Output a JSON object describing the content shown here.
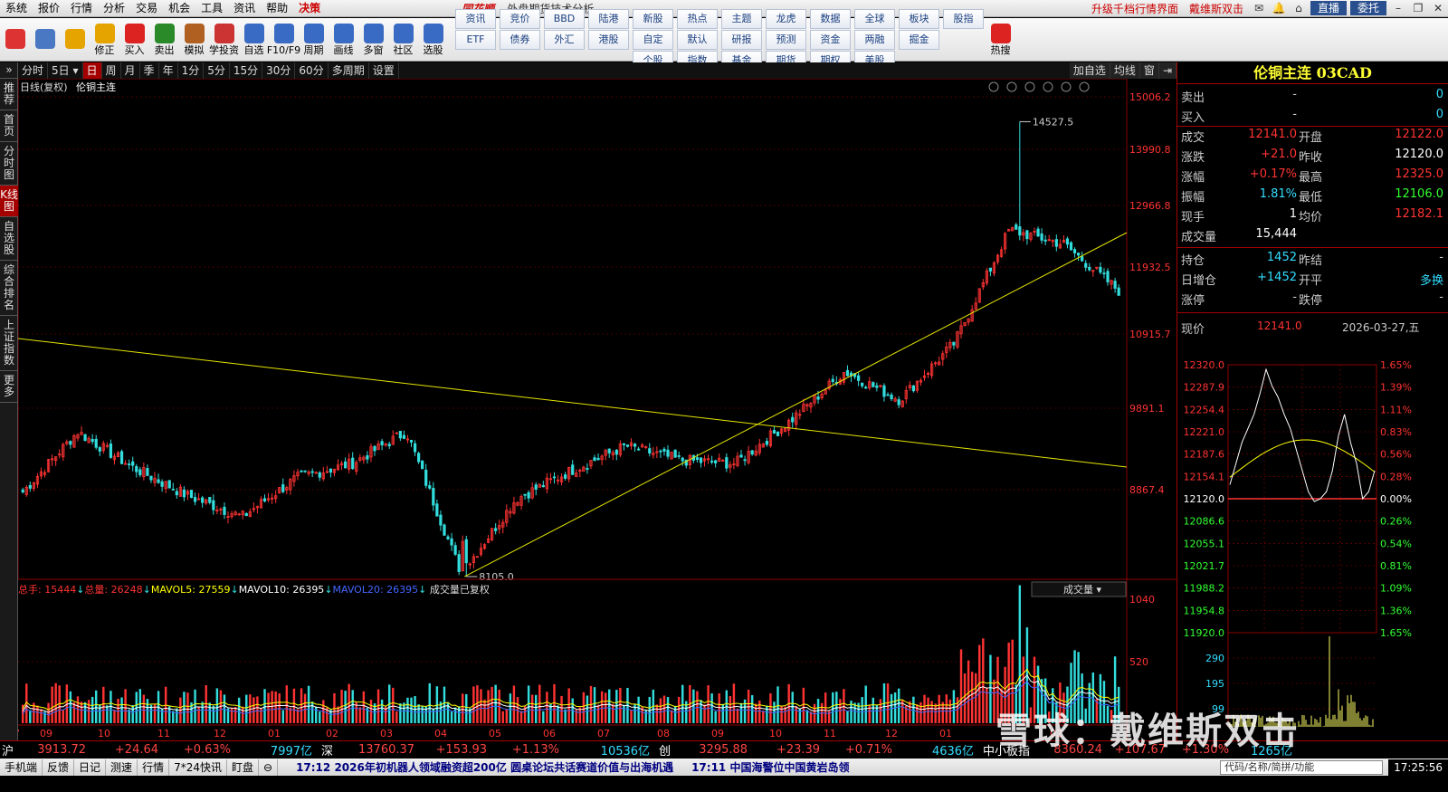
{
  "menubar": {
    "items": [
      "系统",
      "报价",
      "行情",
      "分析",
      "交易",
      "机会",
      "工具",
      "资讯",
      "帮助",
      "决策"
    ],
    "brand": "同花顺",
    "subtitle": "- 外盘期货技术分析",
    "link1": "升级千档行情界面",
    "link2": "戴维斯双击",
    "btn_live": "直播",
    "btn_trust": "委托"
  },
  "toolbar": {
    "big": [
      {
        "label": "",
        "icon": "multi-window-icon",
        "color": "#d33"
      },
      {
        "label": "",
        "icon": "ai-icon",
        "color": "#4a78c2"
      },
      {
        "label": "",
        "icon": "back-arrow-icon",
        "color": "#e5a400"
      },
      {
        "label": "修正",
        "icon": "fix-icon",
        "color": "#e5a400"
      },
      {
        "label": "买入",
        "icon": "buy-icon",
        "color": "#d22"
      },
      {
        "label": "卖出",
        "icon": "sell-icon",
        "color": "#2a8a2a"
      },
      {
        "label": "模拟",
        "icon": "hammer-icon",
        "color": "#b06020"
      },
      {
        "label": "学投资",
        "icon": "learn-icon",
        "color": "#c33"
      },
      {
        "label": "自选",
        "icon": "star-icon",
        "color": "#3a6bc4"
      },
      {
        "label": "F10/F9",
        "icon": "f10-icon",
        "color": "#3a6bc4"
      },
      {
        "label": "周期",
        "icon": "clock-icon",
        "color": "#3a6bc4"
      },
      {
        "label": "画线",
        "icon": "pen-icon",
        "color": "#3a6bc4"
      },
      {
        "label": "多窗",
        "icon": "windows-icon",
        "color": "#3a6bc4"
      },
      {
        "label": "社区",
        "icon": "community-icon",
        "color": "#3a6bc4"
      },
      {
        "label": "选股",
        "icon": "select-icon",
        "color": "#3a6bc4"
      }
    ],
    "grid": [
      "资讯",
      "竞价",
      "BBD",
      "陆港",
      "新股",
      "热点",
      "主题",
      "龙虎",
      "数据",
      "全球",
      "板块",
      "股指",
      "ETF",
      "债券",
      "外汇",
      "港股",
      "自定",
      "默认",
      "研报",
      "预测",
      "资金",
      "两融",
      "掘金",
      "",
      "",
      "",
      "",
      "",
      "个股",
      "指数",
      "基金",
      "期货",
      "期权",
      "美股",
      "",
      ""
    ],
    "tail": [
      {
        "label": "热搜",
        "icon": "hot-search-icon",
        "color": "#d22"
      }
    ]
  },
  "tabbar": {
    "tabs": [
      "分时",
      "5日 ▾",
      "日",
      "周",
      "月",
      "季",
      "年",
      "1分",
      "5分",
      "15分",
      "30分",
      "60分",
      "多周期",
      "设置"
    ],
    "right": [
      "加自选",
      "均线",
      "窗",
      "⇥"
    ]
  },
  "lefttabs": [
    "推荐",
    "首页",
    "分时图",
    "K线图",
    "自选股",
    "综合排名",
    "上证指数",
    "更多"
  ],
  "chart": {
    "label_line": "日线(复权)",
    "label_name": "伦铜主连",
    "y_ticks": [
      "15006.2",
      "13990.8",
      "12966.8",
      "11932.5",
      "10915.7",
      "9891.1",
      "8867.4"
    ],
    "high_label": "14527.5",
    "low_label": "8105.0",
    "x_ticks": [
      "07",
      "09",
      "10",
      "11",
      "12",
      "01",
      "02",
      "03",
      "04",
      "05",
      "06",
      "07",
      "08",
      "09",
      "10",
      "11",
      "12",
      "01",
      "02"
    ],
    "vol_legend": {
      "total_hand": "总手: 15444",
      "total_vol": "总量: 26248",
      "mavol5": "MAVOL5: 27559",
      "mavol10": "MAVOL10: 26395",
      "mavol20": "MAVOL20: 26395",
      "note": "成交量已复权"
    },
    "vol_ticks": [
      "1040",
      "520"
    ],
    "indicator_select": "成交量",
    "colors": {
      "up": "#ff3333",
      "down": "#33dddd",
      "grid": "#8b0000",
      "trend": "#e5e500",
      "ma5": "#ffffff",
      "ma10": "#ffff00",
      "ma20": "#ff00ff",
      "mavol20": "#4466ff"
    }
  },
  "chart_data": {
    "type": "candlestick",
    "title": "伦铜主连",
    "ylim": [
      8105.0,
      15006.2
    ],
    "annotations": [
      {
        "label": "14527.5",
        "type": "high"
      },
      {
        "label": "8105.0",
        "type": "low"
      }
    ],
    "trend_lines": [
      {
        "from": [
          "07",
          10900
        ],
        "to": [
          "03",
          8990
        ]
      },
      {
        "from": [
          "04",
          8105
        ],
        "to": [
          "03",
          12380
        ]
      }
    ],
    "anchor_prices": [
      {
        "x": "07",
        "y": 9300
      },
      {
        "x": "10",
        "y": 10150
      },
      {
        "x": "11",
        "y": 9650
      },
      {
        "x": "12",
        "y": 9250
      },
      {
        "x": "01",
        "y": 8950
      },
      {
        "x": "02",
        "y": 9500
      },
      {
        "x": "03",
        "y": 9700
      },
      {
        "x": "03b",
        "y": 10150
      },
      {
        "x": "04",
        "y": 8150
      },
      {
        "x": "05",
        "y": 9200
      },
      {
        "x": "06",
        "y": 9600
      },
      {
        "x": "07",
        "y": 9950
      },
      {
        "x": "08",
        "y": 9750
      },
      {
        "x": "09",
        "y": 9700
      },
      {
        "x": "10",
        "y": 10300
      },
      {
        "x": "11",
        "y": 11000
      },
      {
        "x": "12",
        "y": 10600
      },
      {
        "x": "01",
        "y": 11400
      },
      {
        "x": "02",
        "y": 13000
      },
      {
        "x": "02b",
        "y": 12800
      },
      {
        "x": "03",
        "y": 12141
      }
    ]
  },
  "rp": {
    "title": "伦铜主连 03CAD",
    "rows": [
      {
        "l": "卖出",
        "v": "-",
        "v2": "0"
      },
      {
        "l": "买入",
        "v": "-",
        "v2": "0"
      }
    ],
    "q": [
      [
        "成交",
        "12141.0",
        "开盘",
        "12122.0"
      ],
      [
        "涨跌",
        "+21.0",
        "昨收",
        "12120.0"
      ],
      [
        "涨幅",
        "+0.17%",
        "最高",
        "12325.0"
      ],
      [
        "振幅",
        "1.81%",
        "最低",
        "12106.0"
      ],
      [
        "现手",
        "1",
        "均价",
        "12182.1"
      ],
      [
        "成交量",
        "15,444",
        "",
        ""
      ]
    ],
    "q2": [
      [
        "持仓",
        "1452",
        "昨结",
        "-"
      ],
      [
        "日增仓",
        "+1452",
        "开平",
        "多换"
      ],
      [
        "涨停",
        "-",
        "跌停",
        "-"
      ]
    ],
    "now_label": "现价",
    "now_price": "12141.0",
    "now_date": "2026-03-27,五",
    "mini_left": [
      "12320.0",
      "12287.9",
      "12254.4",
      "12221.0",
      "12187.6",
      "12154.1",
      "12120.0",
      "12086.6",
      "12055.1",
      "12021.7",
      "11988.2",
      "11954.8",
      "11920.0"
    ],
    "mini_right": [
      "1.65%",
      "1.39%",
      "1.11%",
      "0.83%",
      "0.56%",
      "0.28%",
      "0.00%",
      "0.26%",
      "0.54%",
      "0.81%",
      "1.09%",
      "1.36%",
      "1.65%"
    ],
    "mini_vol": [
      "290",
      "195",
      "99"
    ]
  },
  "idxbar": {
    "sh": "沪",
    "sh_v": "3913.72",
    "sh_c": "+24.64",
    "sh_p": "+0.63%",
    "sh_a": "7997亿",
    "sz": "深",
    "sz_v": "13760.37",
    "sz_c": "+153.93",
    "sz_p": "+1.13%",
    "sz_a": "10536亿",
    "cy": "创",
    "cy_v": "3295.88",
    "cy_c": "+23.39",
    "cy_p": "+0.71%",
    "cy_a": "4636亿",
    "zx": "中小板指",
    "zx_v": "8360.24",
    "zx_c": "+107.67",
    "zx_p": "+1.30%",
    "zx_a": "1265亿"
  },
  "statusbar": {
    "items": [
      "手机端",
      "反馈",
      "日记",
      "测速",
      "行情",
      "7*24快讯",
      "盯盘"
    ],
    "news1": "17:12 2026年初机器人领域融资超200亿 圆桌论坛共话赛道价值与出海机遇",
    "news2": "17:11 中国海警位中国黄岩岛领",
    "search_ph": "代码/名称/简拼/功能",
    "clock": "17:25:56"
  },
  "watermark": "雪球：戴维斯双击"
}
